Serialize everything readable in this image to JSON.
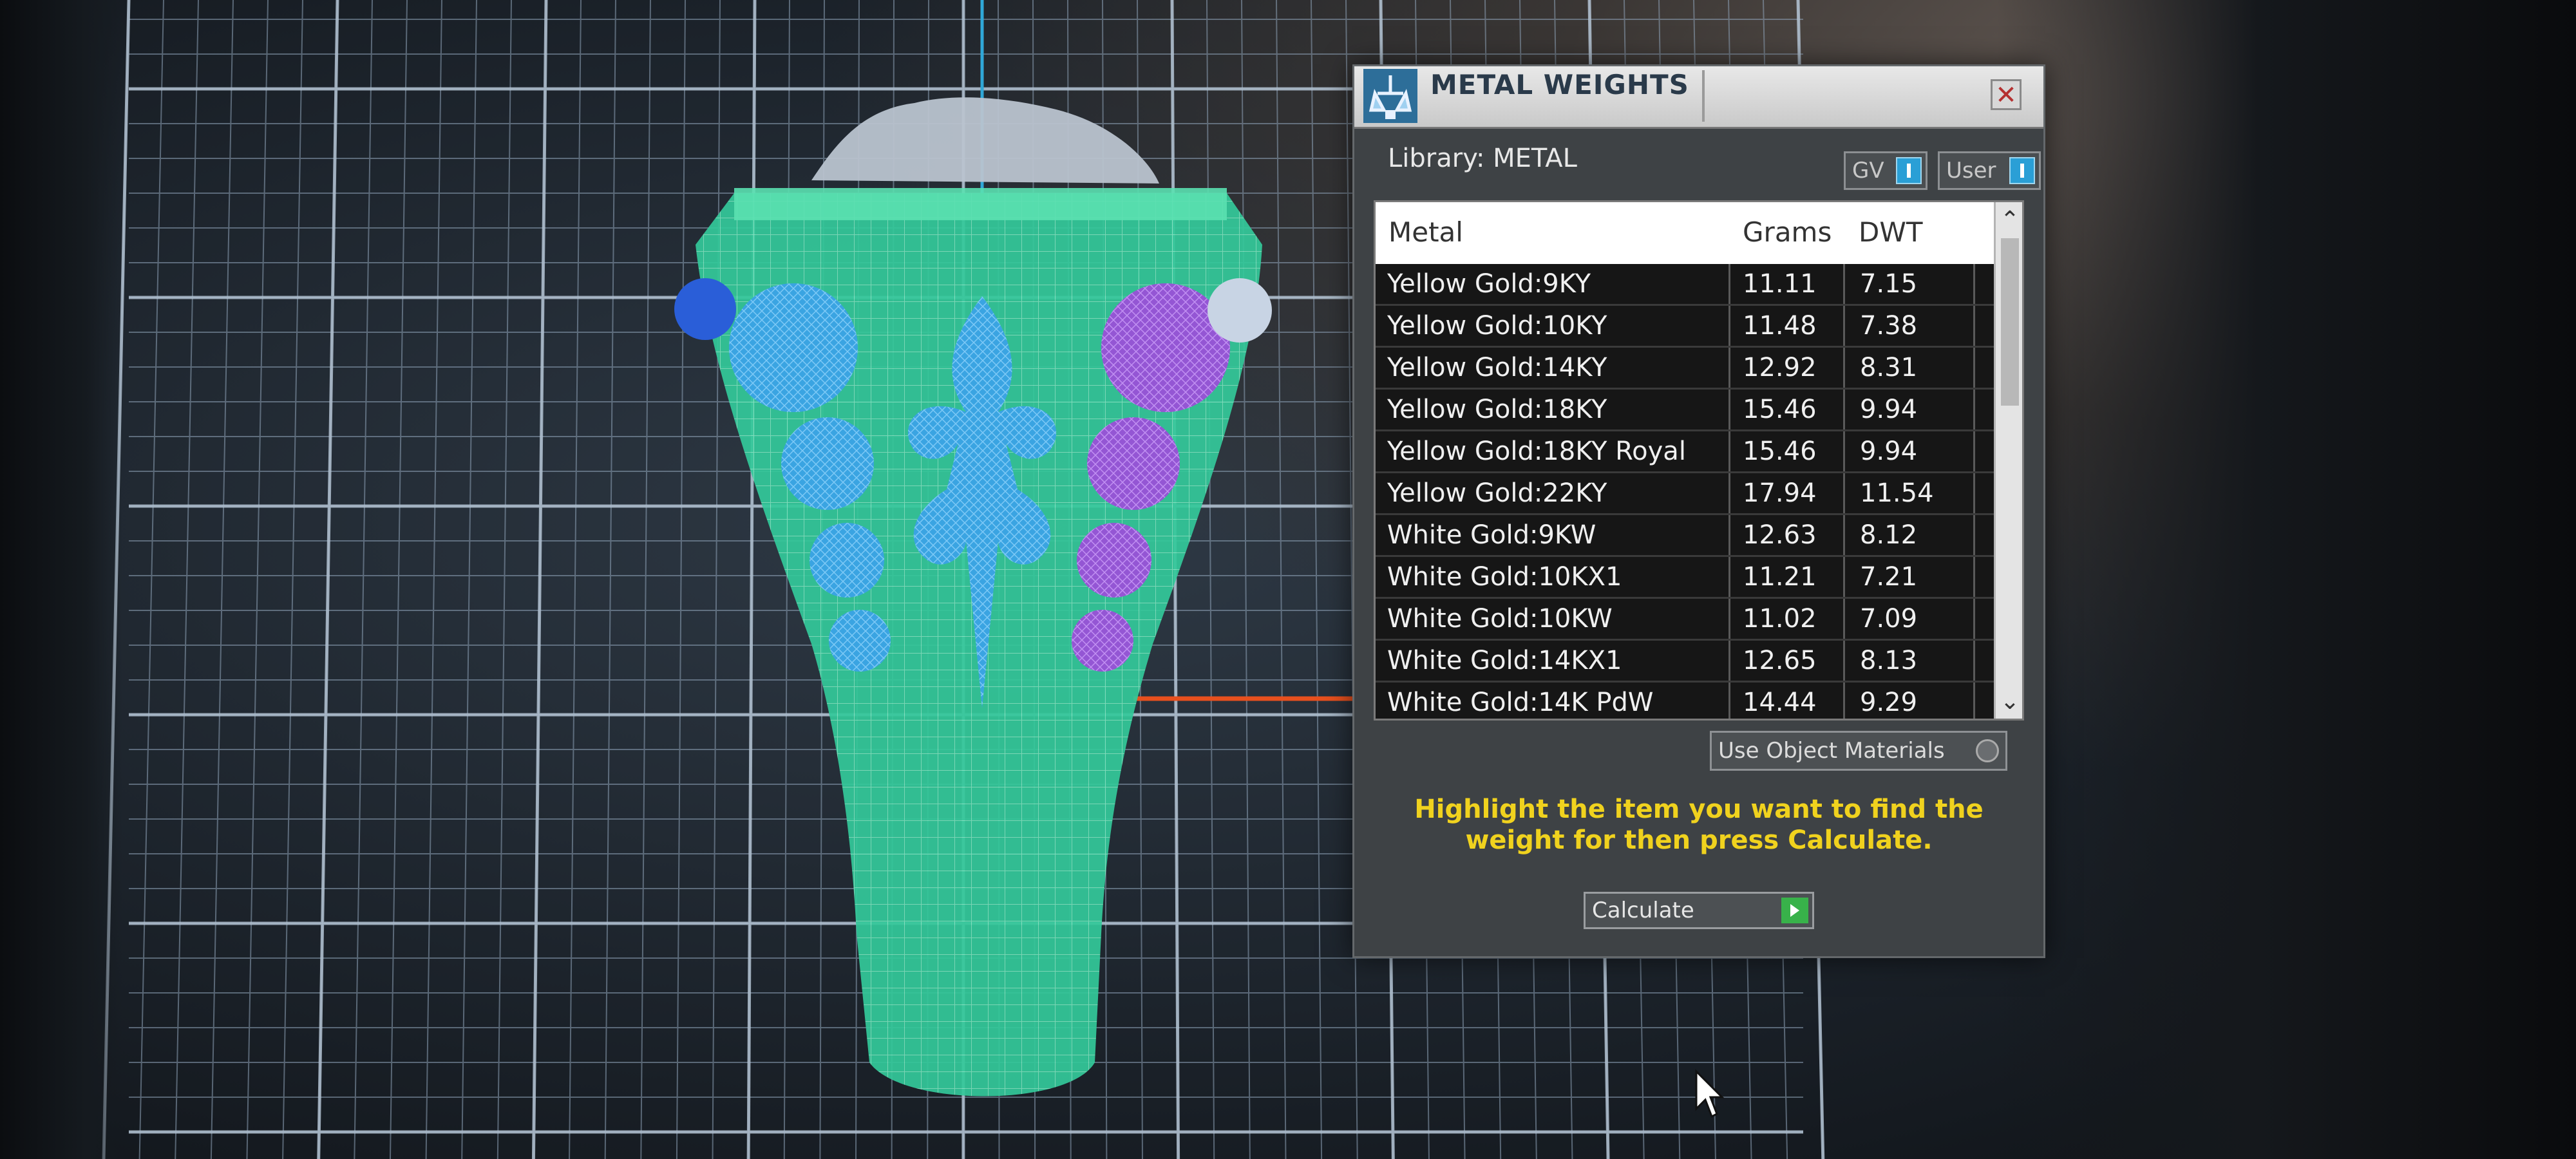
{
  "dialog": {
    "title": "METAL WEIGHTS",
    "close_symbol": "✕",
    "library_label": "Library: METAL",
    "gv_toggle": "GV",
    "user_toggle": "User",
    "use_object_materials": "Use Object Materials",
    "instructions": "Highlight the item you want to find the weight for then press Calculate.",
    "calculate_button": "Calculate"
  },
  "table": {
    "columns": [
      "Metal",
      "Grams",
      "DWT"
    ],
    "rows": [
      {
        "metal": "Yellow Gold:9KY",
        "grams": "11.11",
        "dwt": "7.15"
      },
      {
        "metal": "Yellow Gold:10KY",
        "grams": "11.48",
        "dwt": "7.38"
      },
      {
        "metal": "Yellow Gold:14KY",
        "grams": "12.92",
        "dwt": "8.31"
      },
      {
        "metal": "Yellow Gold:18KY",
        "grams": "15.46",
        "dwt": "9.94"
      },
      {
        "metal": "Yellow Gold:18KY Royal",
        "grams": "15.46",
        "dwt": "9.94"
      },
      {
        "metal": "Yellow Gold:22KY",
        "grams": "17.94",
        "dwt": "11.54"
      },
      {
        "metal": "White Gold:9KW",
        "grams": "12.63",
        "dwt": "8.12"
      },
      {
        "metal": "White Gold:10KX1",
        "grams": "11.21",
        "dwt": "7.21"
      },
      {
        "metal": "White Gold:10KW",
        "grams": "11.02",
        "dwt": "7.09"
      },
      {
        "metal": "White Gold:14KX1",
        "grams": "12.65",
        "dwt": "8.13"
      },
      {
        "metal": "White Gold:14K PdW",
        "grams": "14.44",
        "dwt": "9.29"
      }
    ]
  },
  "icons": {
    "app_icon": "metal-weights-icon",
    "close_icon": "close-icon",
    "scroll_up_icon": "chevron-up-icon",
    "scroll_down_icon": "chevron-down-icon",
    "calculate_icon": "play-icon",
    "cursor_icon": "mouse-cursor-icon"
  },
  "colors": {
    "instruction_text": "#f0d21e",
    "toggle_knob": "#2a9fd6",
    "calculate_go": "#38b24a",
    "ring_wireframe": "#3fd6a0",
    "gem_blue": "#3a9ee0",
    "gem_purple": "#9a5ad8"
  },
  "scroll_arrows": {
    "up": "⌃",
    "down": "⌄"
  }
}
